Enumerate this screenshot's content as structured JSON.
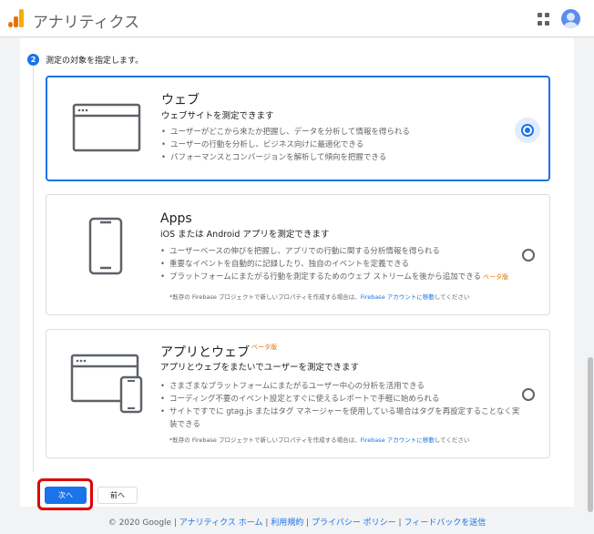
{
  "header": {
    "app_title": "アナリティクス",
    "apps_icon": "grid-icon",
    "account_icon": "account-avatar-icon"
  },
  "step": {
    "number": "2",
    "label": "測定の対象を指定します。"
  },
  "cards": [
    {
      "title": "ウェブ",
      "subtitle": "ウェブサイトを測定できます",
      "bullets": [
        "ユーザーがどこから来たか把握し、データを分析して情報を得られる",
        "ユーザーの行動を分析し、ビジネス向けに最適化できる",
        "パフォーマンスとコンバージョンを解析して傾向を把握できる"
      ],
      "selected": true
    },
    {
      "title": "Apps",
      "subtitle": "iOS または Android アプリを測定できます",
      "bullets": [
        "ユーザーベースの伸びを把握し、アプリでの行動に関する分析情報を得られる",
        "重要なイベントを自動的に記録したり、独自のイベントを定義できる",
        "プラットフォームにまたがる行動を測定するためのウェブ ストリームを後から追加できる"
      ],
      "beta": "ベータ版",
      "footnote_prefix": "*既存の Firebase プロジェクトで新しいプロパティを作成する場合は、",
      "footnote_link": "Firebase アカウントに移動",
      "footnote_suffix": "してください",
      "selected": false
    },
    {
      "title": "アプリとウェブ",
      "title_beta": "ベータ版",
      "subtitle": "アプリとウェブをまたいでユーザーを測定できます",
      "bullets": [
        "さまざまなプラットフォームにまたがるユーザー中心の分析を活用できる",
        "コーディング不要のイベント設定とすぐに使えるレポートで手軽に始められる",
        "サイトですでに gtag.js またはタグ マネージャーを使用している場合はタグを再設定することなく実装できる"
      ],
      "footnote_prefix": "*既存の Firebase プロジェクトで新しいプロパティを作成する場合は、",
      "footnote_link": "Firebase アカウントに移動",
      "footnote_suffix": "してください",
      "selected": false
    }
  ],
  "buttons": {
    "next": "次へ",
    "back": "前へ"
  },
  "footer": {
    "copyright": "© 2020 Google | ",
    "links": [
      "アナリティクス ホーム",
      "利用規約",
      "プライバシー ポリシー",
      "フィードバックを送信"
    ],
    "separator": " | "
  },
  "colors": {
    "accent": "#1a73e8",
    "beta": "#e37400",
    "highlight": "#e00000"
  }
}
